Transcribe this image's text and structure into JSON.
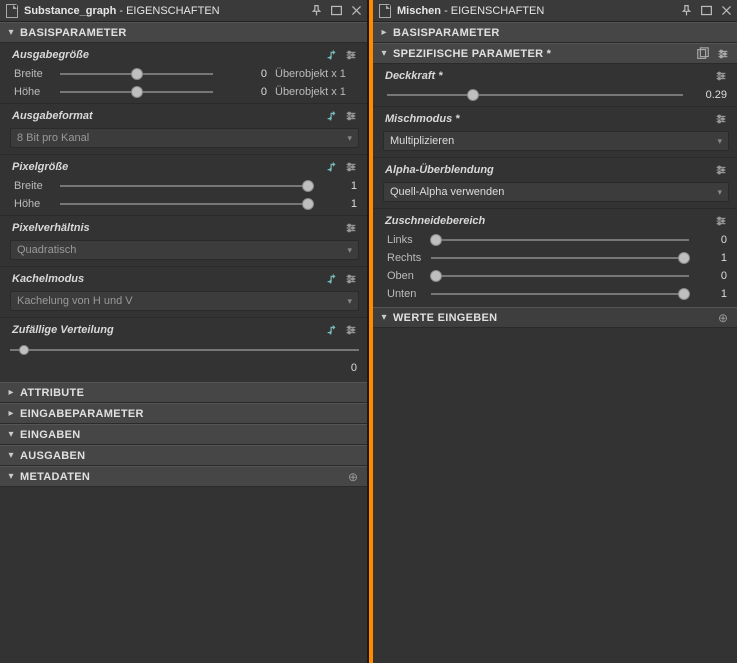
{
  "left": {
    "title_strong": "Substance_graph",
    "title_rest": " - EIGENSCHAFTEN",
    "sections": {
      "basis": {
        "label": "BASISPARAMETER",
        "output_size": {
          "label": "Ausgabegröße",
          "width_label": "Breite",
          "width_value": "0",
          "width_suffix": "Überobjekt x 1",
          "height_label": "Höhe",
          "height_value": "0",
          "height_suffix": "Überobjekt x 1"
        },
        "output_format": {
          "label": "Ausgabeformat",
          "value": "8 Bit pro Kanal"
        },
        "pixel_size": {
          "label": "Pixelgröße",
          "width_label": "Breite",
          "width_value": "1",
          "height_label": "Höhe",
          "height_value": "1"
        },
        "pixel_ratio": {
          "label": "Pixelverhältnis",
          "value": "Quadratisch"
        },
        "tile_mode": {
          "label": "Kachelmodus",
          "value": "Kachelung von H und V"
        },
        "random": {
          "label": "Zufällige Verteilung",
          "value": "0"
        }
      },
      "collapsed": {
        "attribute": "ATTRIBUTE",
        "eingabeparam": "EINGABEPARAMETER",
        "eingaben": "EINGABEN",
        "ausgaben": "AUSGABEN",
        "metadaten": "METADATEN"
      }
    }
  },
  "right": {
    "title_strong": "Mischen",
    "title_rest": " - EIGENSCHAFTEN",
    "basis_label": "BASISPARAMETER",
    "specific": {
      "label": "SPEZIFISCHE PARAMETER *",
      "opacity": {
        "label": "Deckkraft *",
        "value": "0.29"
      },
      "blendmode": {
        "label": "Mischmodus *",
        "value": "Multiplizieren"
      },
      "alphablend": {
        "label": "Alpha-Überblendung",
        "value": "Quell-Alpha verwenden"
      },
      "crop": {
        "label": "Zuschneidebereich",
        "left": {
          "label": "Links",
          "value": "0"
        },
        "right": {
          "label": "Rechts",
          "value": "1"
        },
        "top": {
          "label": "Oben",
          "value": "0"
        },
        "bottom": {
          "label": "Unten",
          "value": "1"
        }
      }
    },
    "werte_label": "WERTE EINGEBEN"
  }
}
